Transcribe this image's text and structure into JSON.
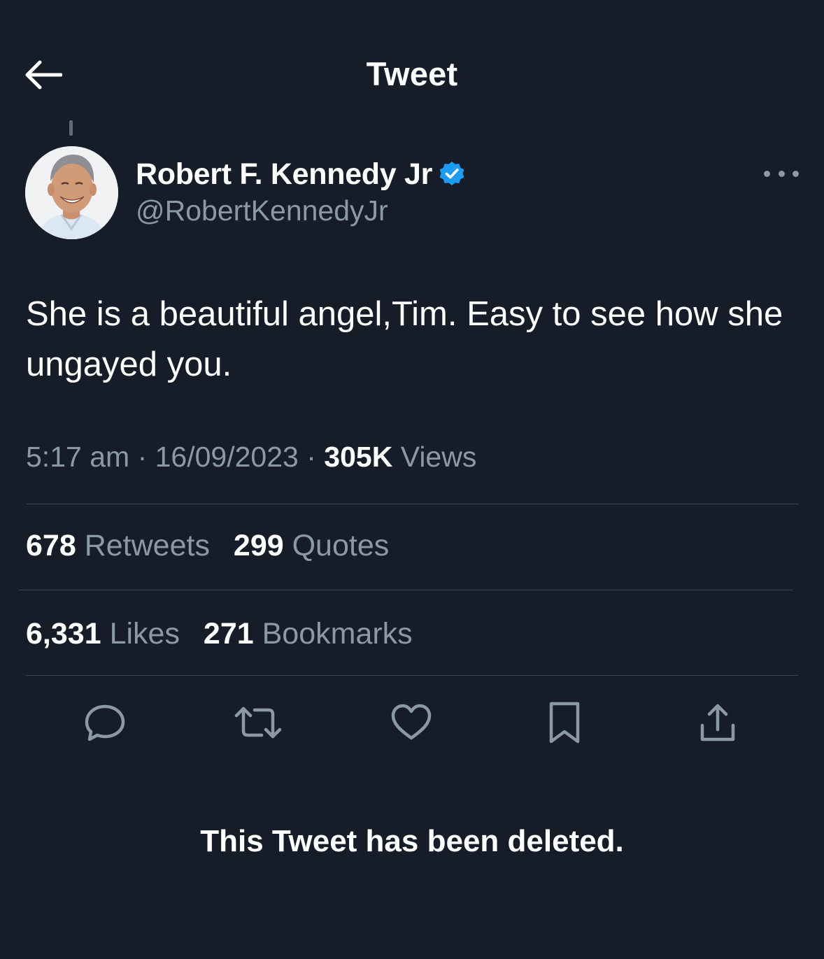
{
  "header": {
    "title": "Tweet",
    "back_icon": "arrow-left-icon"
  },
  "tweet": {
    "author": {
      "name": "Robert F. Kennedy Jr",
      "handle": "@RobertKennedyJr",
      "verified": true,
      "verified_color": "#1d9bf0"
    },
    "text": "She is a beautiful angel,Tim. Easy to see how she ungayed you.",
    "time": "5:17 am",
    "separator": "·",
    "date": "16/09/2023",
    "views_count": "305K",
    "views_label": "Views"
  },
  "stats": {
    "retweets_count": "678",
    "retweets_label": "Retweets",
    "quotes_count": "299",
    "quotes_label": "Quotes",
    "likes_count": "6,331",
    "likes_label": "Likes",
    "bookmarks_count": "271",
    "bookmarks_label": "Bookmarks"
  },
  "actions": [
    "reply-icon",
    "retweet-icon",
    "like-icon",
    "bookmark-icon",
    "share-icon"
  ],
  "notice": {
    "text": "This Tweet has been deleted."
  },
  "colors": {
    "background": "#171d28",
    "text_primary": "#ffffff",
    "text_secondary": "#8b98a5",
    "divider": "#38444d",
    "accent": "#1d9bf0"
  }
}
